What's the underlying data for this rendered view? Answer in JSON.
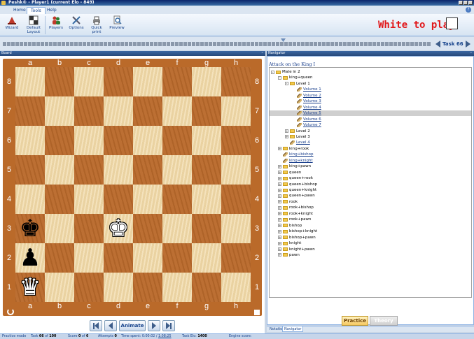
{
  "window": {
    "title": "Peshk® - Player1 (current Elo - 849)"
  },
  "menu": {
    "tabs": [
      "Home",
      "Tools",
      "Help"
    ],
    "active": "Tools"
  },
  "ribbon": {
    "buttons": [
      {
        "label": "Wizard",
        "icon": "wizard-hat-icon"
      },
      {
        "label": "Default Layout",
        "icon": "layout-icon"
      },
      {
        "label": "Players",
        "icon": "players-icon"
      },
      {
        "label": "Options",
        "icon": "options-tools-icon"
      },
      {
        "label": "Quick print",
        "icon": "printer-icon"
      },
      {
        "label": "Preview",
        "icon": "magnifier-icon"
      }
    ]
  },
  "turn": {
    "text": "White to play",
    "color": "#e1181b"
  },
  "task_nav": {
    "label": "Task 66"
  },
  "board": {
    "panel_title": "Board",
    "files": [
      "a",
      "b",
      "c",
      "d",
      "e",
      "f",
      "g",
      "h"
    ],
    "ranks": [
      "8",
      "7",
      "6",
      "5",
      "4",
      "3",
      "2",
      "1"
    ],
    "light_color": "#f1d9a6",
    "dark_color": "#b9692b",
    "pieces": [
      {
        "square": "a3",
        "glyph": "♚",
        "side": "black",
        "name": "black-king"
      },
      {
        "square": "d3",
        "glyph": "♚",
        "side": "white",
        "name": "white-king"
      },
      {
        "square": "a2",
        "glyph": "♟",
        "side": "black",
        "name": "black-pawn"
      },
      {
        "square": "a1",
        "glyph": "♛",
        "side": "white",
        "name": "white-queen"
      }
    ],
    "controls": {
      "animate_label": "Animate"
    }
  },
  "navigator": {
    "panel_title": "Navigator",
    "heading": "Attack on the King I",
    "tree": [
      {
        "label": "Mate in 2",
        "depth": 0,
        "kind": "folder",
        "toggle": "-"
      },
      {
        "label": "king+queen",
        "depth": 1,
        "kind": "folder",
        "toggle": "-"
      },
      {
        "label": "Level 1",
        "depth": 2,
        "kind": "folder",
        "toggle": "-"
      },
      {
        "label": "Volume 1",
        "depth": 3,
        "kind": "item"
      },
      {
        "label": "Volume 2",
        "depth": 3,
        "kind": "item"
      },
      {
        "label": "Volume 3",
        "depth": 3,
        "kind": "item"
      },
      {
        "label": "Volume 4",
        "depth": 3,
        "kind": "item"
      },
      {
        "label": "Volume 5",
        "depth": 3,
        "kind": "item",
        "selected": true
      },
      {
        "label": "Volume 6",
        "depth": 3,
        "kind": "item"
      },
      {
        "label": "Volume 7",
        "depth": 3,
        "kind": "item"
      },
      {
        "label": "Level 2",
        "depth": 2,
        "kind": "folder",
        "toggle": "+"
      },
      {
        "label": "Level 3",
        "depth": 2,
        "kind": "folder",
        "toggle": "+"
      },
      {
        "label": "Level 4",
        "depth": 2,
        "kind": "item"
      },
      {
        "label": "king+rook",
        "depth": 1,
        "kind": "folder",
        "toggle": "+"
      },
      {
        "label": "king+bishop",
        "depth": 1,
        "kind": "item"
      },
      {
        "label": "king+knight",
        "depth": 1,
        "kind": "item"
      },
      {
        "label": "king+pawn",
        "depth": 1,
        "kind": "folder",
        "toggle": "+"
      },
      {
        "label": "queen",
        "depth": 1,
        "kind": "folder",
        "toggle": "+"
      },
      {
        "label": "queen+rook",
        "depth": 1,
        "kind": "folder",
        "toggle": "+"
      },
      {
        "label": "queen+bishop",
        "depth": 1,
        "kind": "folder",
        "toggle": "+"
      },
      {
        "label": "queen+knight",
        "depth": 1,
        "kind": "folder",
        "toggle": "+"
      },
      {
        "label": "queen+pawn",
        "depth": 1,
        "kind": "folder",
        "toggle": "+"
      },
      {
        "label": "rook",
        "depth": 1,
        "kind": "folder",
        "toggle": "+"
      },
      {
        "label": "rook+bishop",
        "depth": 1,
        "kind": "folder",
        "toggle": "+"
      },
      {
        "label": "rook+knight",
        "depth": 1,
        "kind": "folder",
        "toggle": "+"
      },
      {
        "label": "rook+pawn",
        "depth": 1,
        "kind": "folder",
        "toggle": "+"
      },
      {
        "label": "bishop",
        "depth": 1,
        "kind": "folder",
        "toggle": "+"
      },
      {
        "label": "bishop+knight",
        "depth": 1,
        "kind": "folder",
        "toggle": "+"
      },
      {
        "label": "bishop+pawn",
        "depth": 1,
        "kind": "folder",
        "toggle": "+"
      },
      {
        "label": "knight",
        "depth": 1,
        "kind": "folder",
        "toggle": "+"
      },
      {
        "label": "knight+pawn",
        "depth": 1,
        "kind": "folder",
        "toggle": "+"
      },
      {
        "label": "pawn",
        "depth": 1,
        "kind": "folder",
        "toggle": "+"
      }
    ],
    "practice_label": "Practice",
    "theory_label": "Theory",
    "tabs": [
      "Notation",
      "Navigator"
    ],
    "active_tab": "Navigator"
  },
  "status": {
    "mode": "Practice mode",
    "task_prefix": "Task",
    "task_num": "66",
    "task_of": "of",
    "task_total": "100",
    "score_prefix": "Score",
    "score_val": "0",
    "score_of": "of",
    "score_total": "6",
    "attempts_prefix": "Attempts",
    "attempts_val": "0",
    "time_prefix": "Time spent:",
    "time_val": "0:00:02",
    "time_sep": "/",
    "time_total": "1:08:25",
    "elo_prefix": "Task Elo:",
    "elo_val": "1400",
    "engine_label": "Engine score:"
  }
}
